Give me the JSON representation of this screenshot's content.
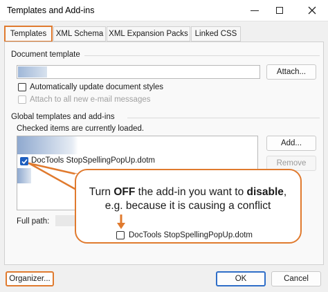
{
  "window": {
    "title": "Templates and Add-ins",
    "minimize_icon": "minimize-icon",
    "close_icon": "close-icon"
  },
  "tabs": [
    {
      "label": "Templates",
      "active": true
    },
    {
      "label": "XML Schema",
      "active": false
    },
    {
      "label": "XML Expansion Packs",
      "active": false
    },
    {
      "label": "Linked CSS",
      "active": false
    }
  ],
  "document_template": {
    "group_label": "Document template",
    "path_value": "",
    "attach_label": "Attach...",
    "auto_update_label": "Automatically update document styles",
    "auto_update_checked": false,
    "attach_email_label": "Attach to all new e-mail messages",
    "attach_email_checked": false,
    "attach_email_disabled": true
  },
  "global_templates": {
    "group_label": "Global templates and add-ins",
    "hint": "Checked items are currently loaded.",
    "items": [
      {
        "label": "",
        "checked": false
      },
      {
        "label": "DocTools StopSpellingPopUp.dotm",
        "checked": true
      },
      {
        "label": "",
        "checked": false
      }
    ],
    "add_label": "Add...",
    "remove_label": "Remove",
    "full_path_label": "Full path:"
  },
  "callout": {
    "line1_pre": "Turn ",
    "line1_b1": "OFF",
    "line1_mid": " the add-in you want to ",
    "line1_b2": "disable",
    "line1_post": ",",
    "line2": "e.g. because it is causing a conflict",
    "example_item": "DocTools StopSpellingPopUp.dotm",
    "accent_color": "#e07a2e"
  },
  "footer": {
    "organizer_label": "Organizer...",
    "ok_label": "OK",
    "cancel_label": "Cancel"
  }
}
